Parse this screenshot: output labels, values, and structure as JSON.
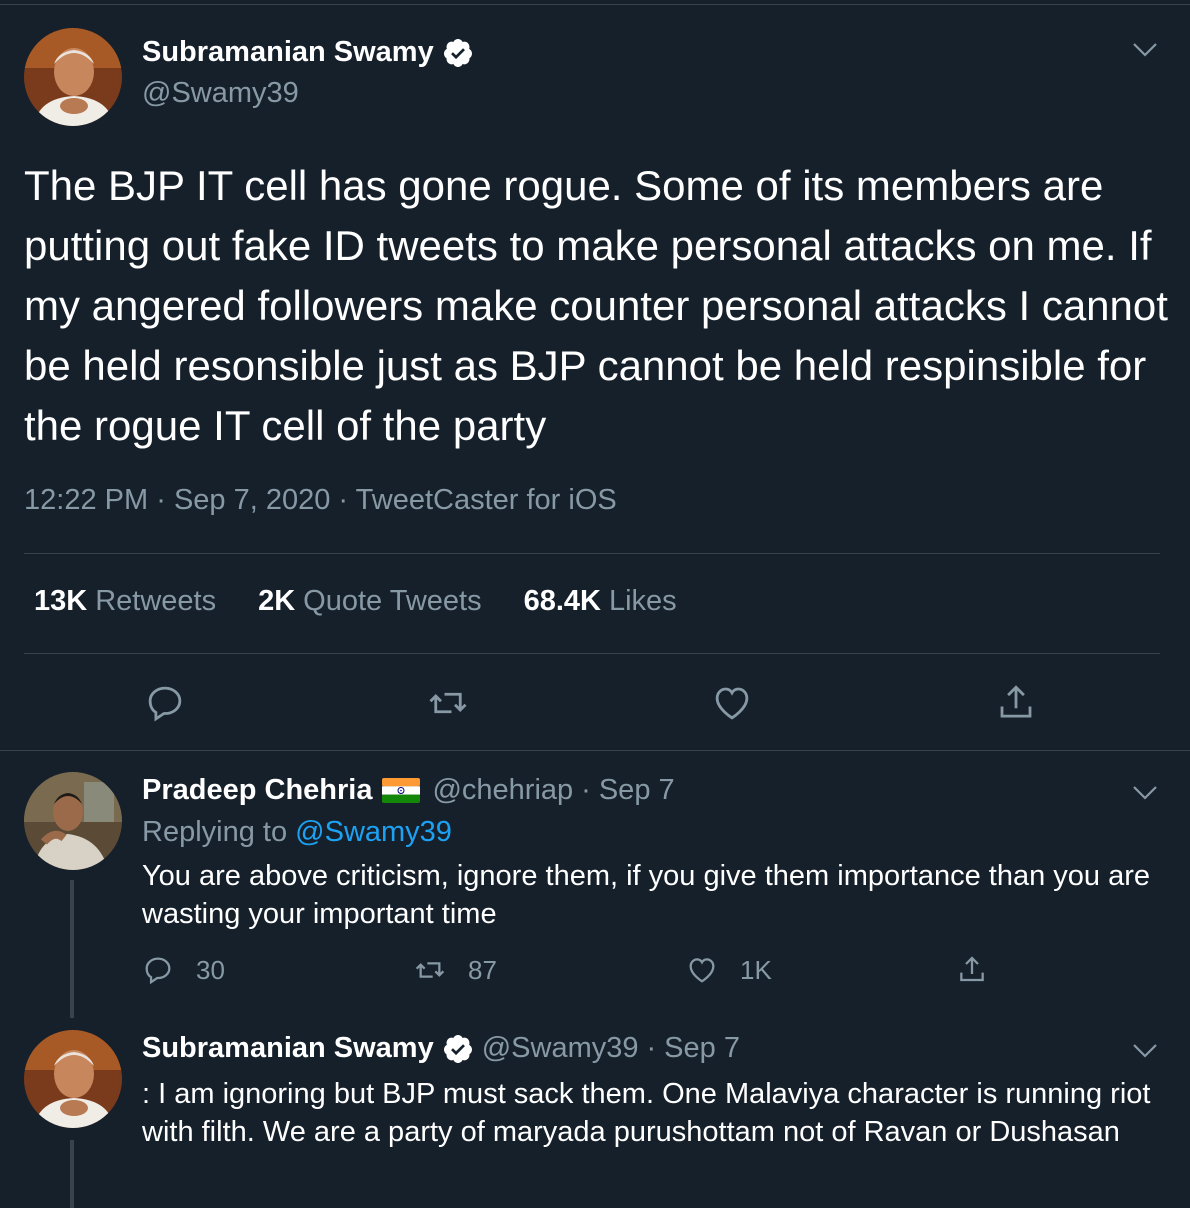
{
  "main_tweet": {
    "author_name": "Subramanian Swamy",
    "author_handle": "@Swamy39",
    "text": "The BJP IT cell has gone rogue. Some of its members are putting out fake ID tweets to make personal attacks on me. If my angered followers make counter personal attacks I cannot be held resonsible just as BJP cannot be held respinsible for the rogue IT cell of the party",
    "time": "12:22 PM",
    "date": "Sep 7, 2020",
    "source": "TweetCaster for iOS",
    "stats": {
      "retweets_count": "13K",
      "retweets_label": "Retweets",
      "quotes_count": "2K",
      "quotes_label": "Quote Tweets",
      "likes_count": "68.4K",
      "likes_label": "Likes"
    },
    "actions": [
      "reply-icon",
      "retweet-icon",
      "like-icon",
      "share-icon"
    ]
  },
  "replies": [
    {
      "author_name": "Pradeep Chehria",
      "author_handle": "@chehriap",
      "date": "Sep 7",
      "replying_prefix": "Replying to",
      "replying_handle": "@Swamy39",
      "text": "You are above criticism, ignore them, if you give them importance than you are wasting your important time",
      "reply_count": "30",
      "retweet_count": "87",
      "like_count": "1K"
    },
    {
      "author_name": "Subramanian Swamy",
      "author_handle": "@Swamy39",
      "date": "Sep 7",
      "text": ": I am ignoring but BJP must sack them. One Malaviya character is running riot with filth. We are a party of maryada purushottam not of Ravan or Dushasan"
    }
  ],
  "separator": "·",
  "colors": {
    "background": "#15202b",
    "secondary_text": "#8899a6",
    "divider": "#38444d",
    "link": "#1da1f2"
  }
}
